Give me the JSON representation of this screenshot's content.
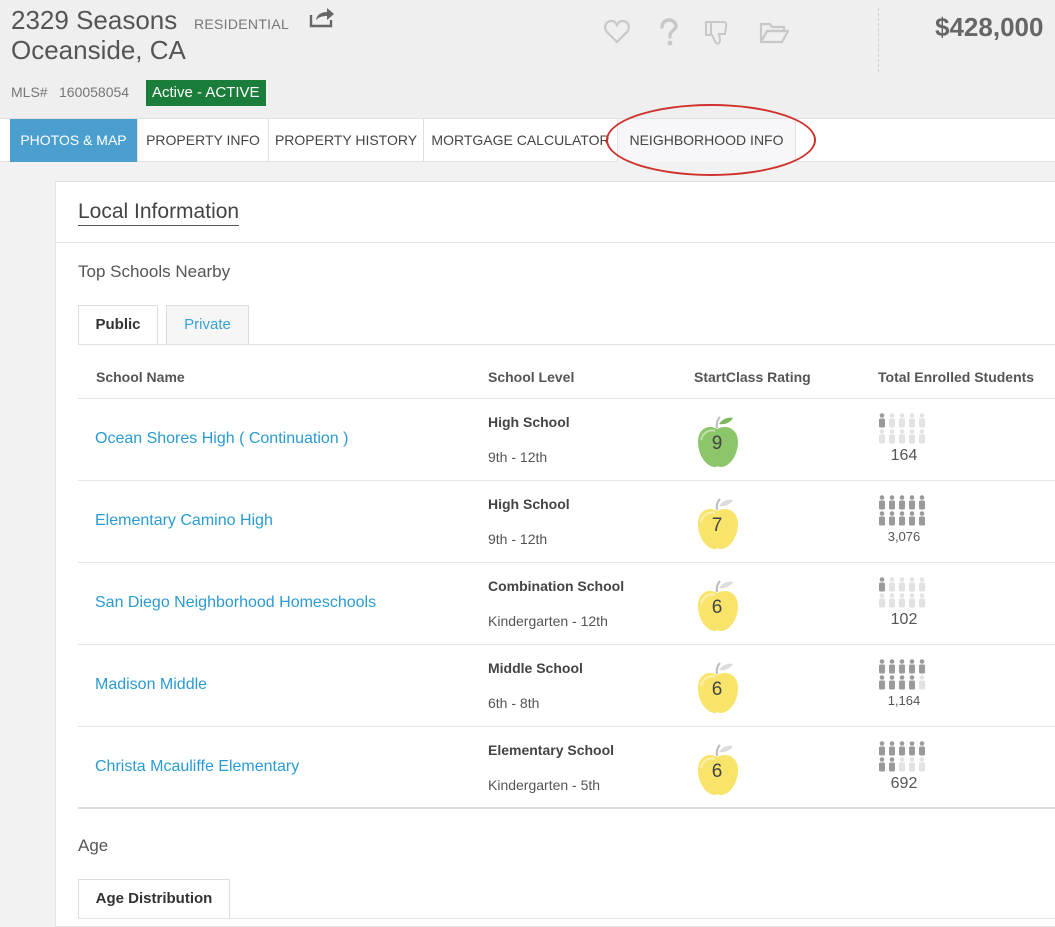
{
  "header": {
    "address_line1": "2329 Seasons",
    "address_line2": "Oceanside, CA",
    "property_type": "RESIDENTIAL",
    "mls_label": "MLS#",
    "mls_number": "160058054",
    "status": "Active - ACTIVE",
    "price": "$428,000",
    "status_color": "#1a7d3a",
    "icons": [
      "share-icon",
      "heart-icon",
      "question-icon",
      "thumbs-down-icon",
      "folder-icon"
    ]
  },
  "tabs": [
    {
      "label": "PHOTOS & MAP"
    },
    {
      "label": "PROPERTY INFO"
    },
    {
      "label": "PROPERTY HISTORY"
    },
    {
      "label": "MORTGAGE CALCULATOR"
    },
    {
      "label": "NEIGHBORHOOD INFO"
    }
  ],
  "local": {
    "title": "Local Information",
    "schools_title": "Top Schools Nearby",
    "school_tabs": [
      "Public",
      "Private"
    ],
    "columns": [
      "School Name",
      "School Level",
      "StartClass Rating",
      "Total Enrolled Students"
    ],
    "schools": [
      {
        "name": "Ocean Shores High ( Continuation )",
        "level": "High School",
        "grades": "9th - 12th",
        "rating": "9",
        "rating_color": "green",
        "enrolled": "164",
        "icons_filled": 1
      },
      {
        "name": "Elementary Camino High",
        "level": "High School",
        "grades": "9th - 12th",
        "rating": "7",
        "rating_color": "yellow",
        "enrolled": "3,076",
        "icons_filled": 10
      },
      {
        "name": "San Diego Neighborhood Homeschools",
        "level": "Combination School",
        "grades": "Kindergarten - 12th",
        "rating": "6",
        "rating_color": "yellow",
        "enrolled": "102",
        "icons_filled": 1
      },
      {
        "name": "Madison Middle",
        "level": "Middle School",
        "grades": "6th - 8th",
        "rating": "6",
        "rating_color": "yellow",
        "enrolled": "1,164",
        "icons_filled": 9
      },
      {
        "name": "Christa Mcauliffe Elementary",
        "level": "Elementary School",
        "grades": "Kindergarten - 5th",
        "rating": "6",
        "rating_color": "yellow",
        "enrolled": "692",
        "icons_filled": 7
      }
    ],
    "age_title": "Age",
    "age_tabs": [
      "Age Distribution"
    ]
  }
}
